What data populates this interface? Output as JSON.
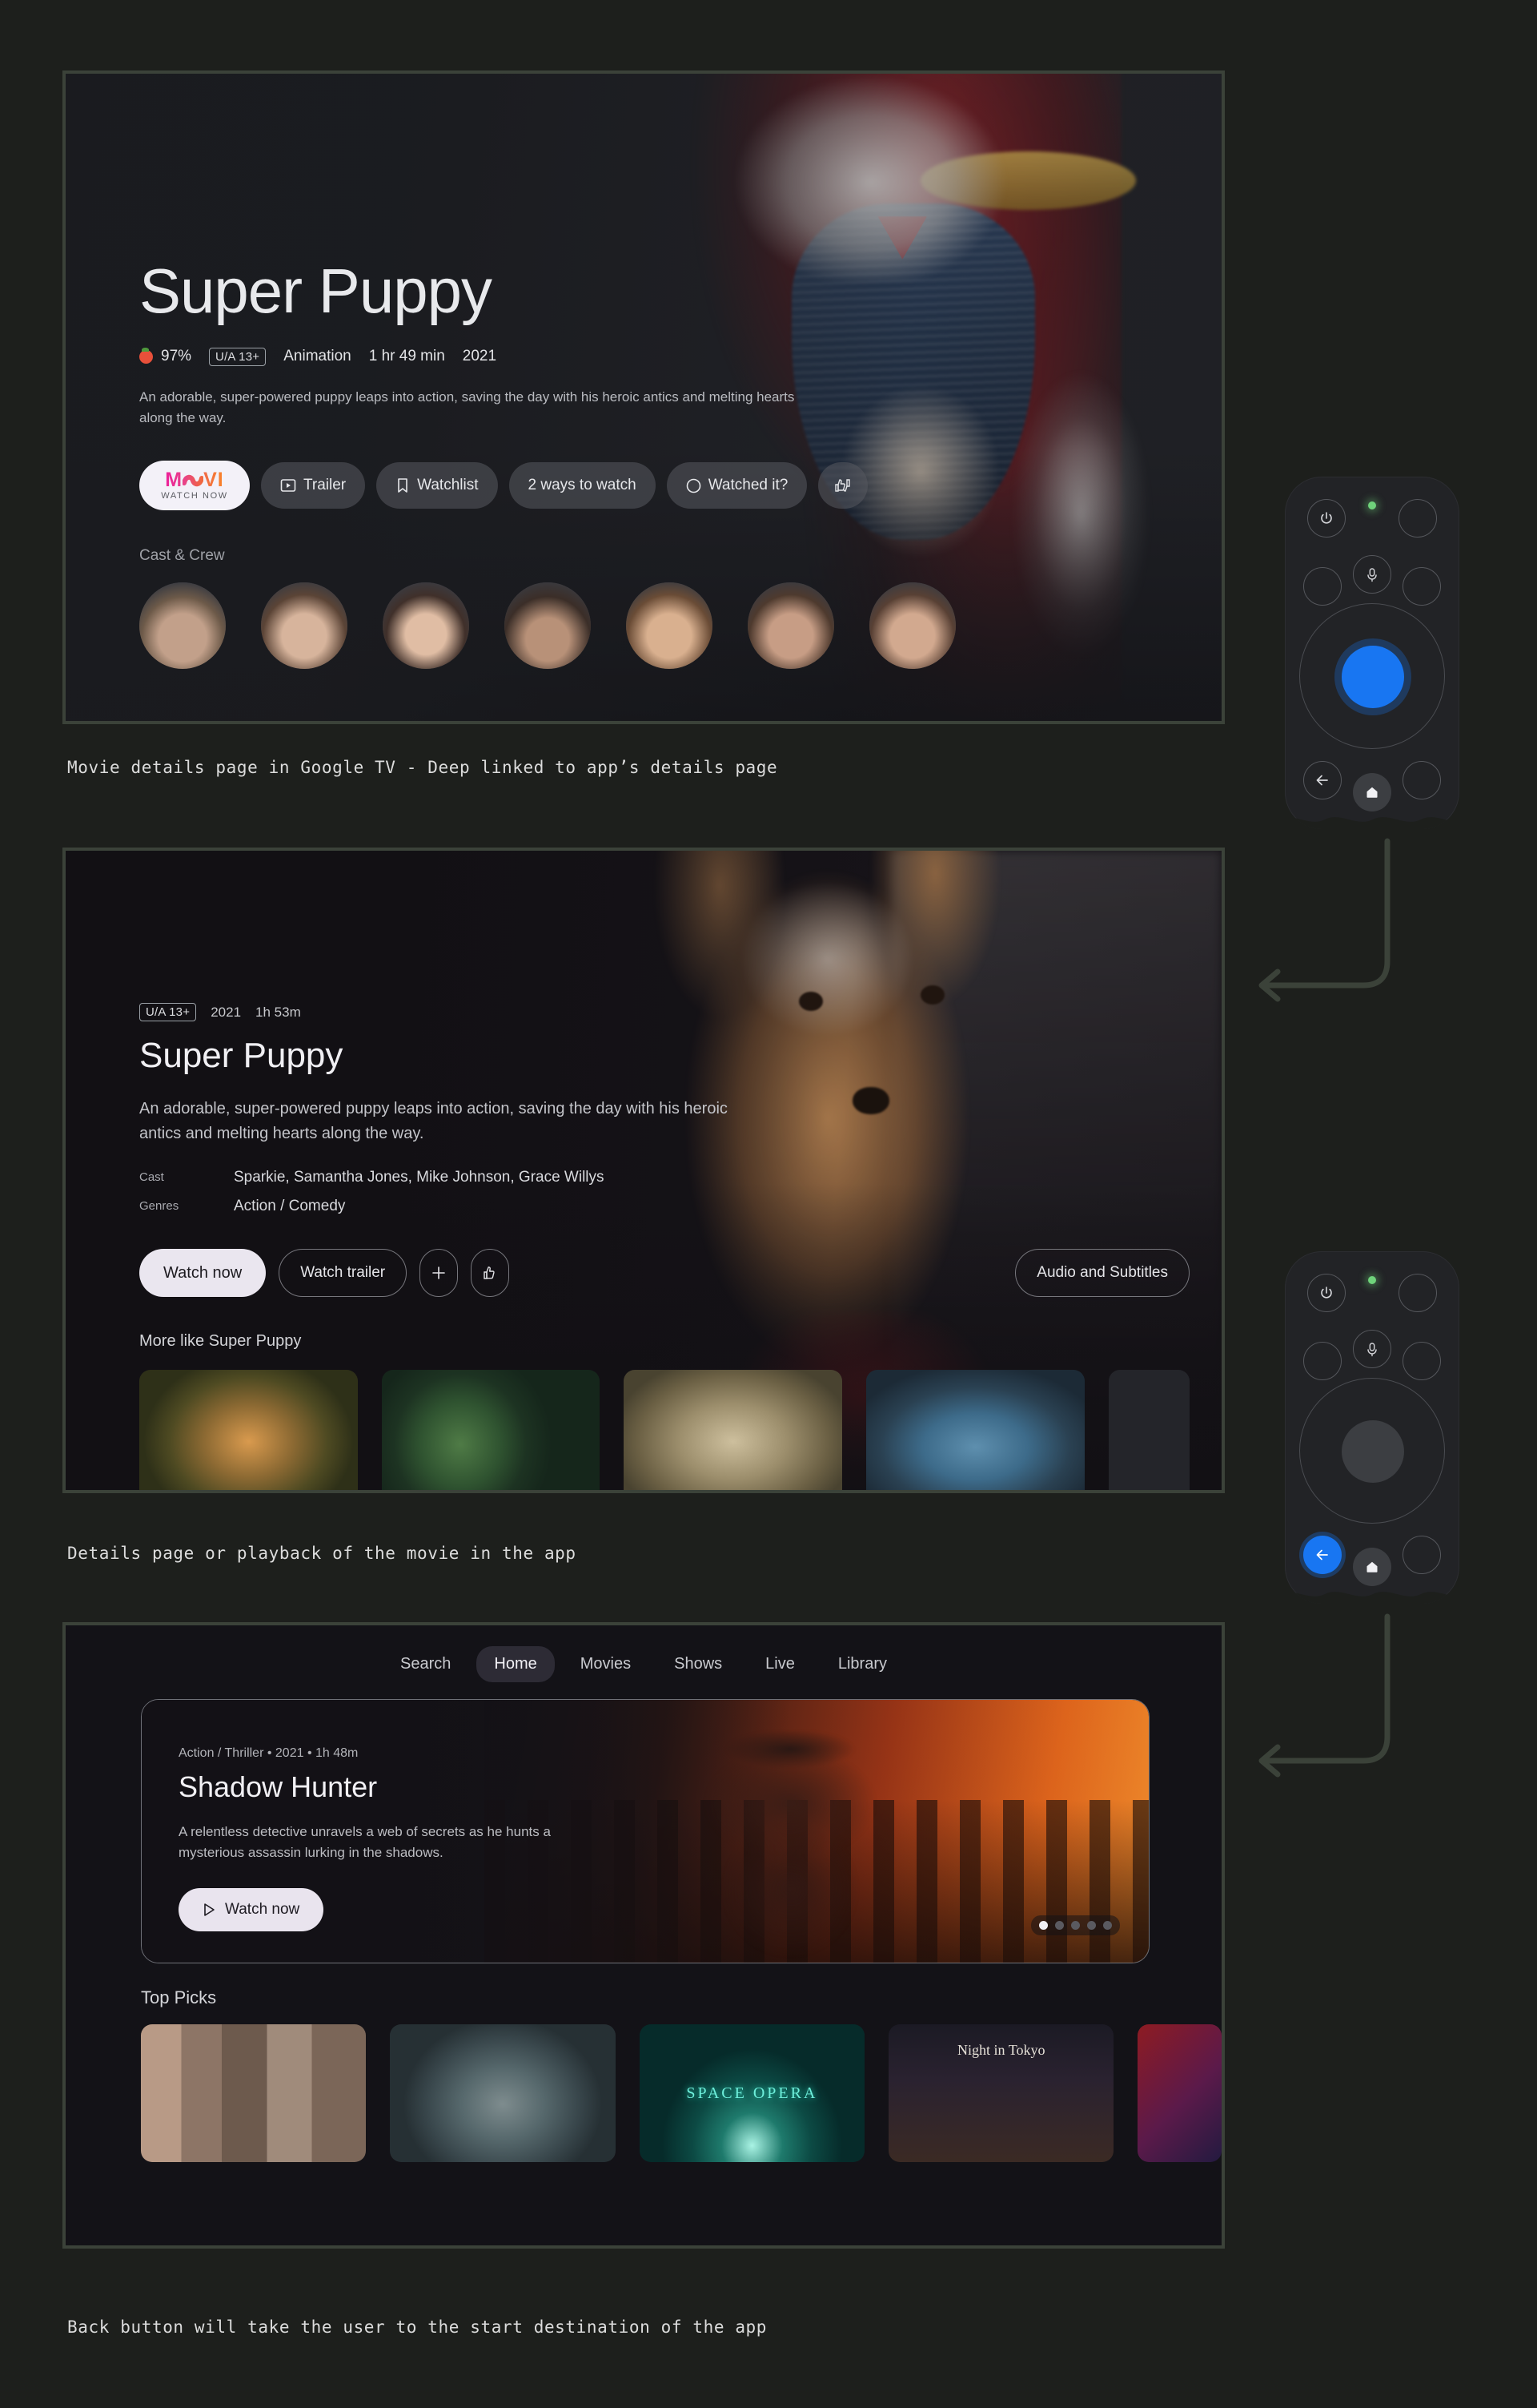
{
  "captions": {
    "first": "Movie details page in Google TV - Deep linked to app’s details page",
    "second": "Details page or playback of the movie in the app",
    "third": "Back button will take the user to the start destination of the app"
  },
  "colors": {
    "canvas": "#1d1f1c",
    "frame_border": "#3b4239",
    "accent_blue": "#1876f2",
    "led_green": "#6fd37b",
    "tomato_red": "#e8503a",
    "movi_gradient_start": "#ec1e9a",
    "movi_gradient_end": "#f98327",
    "light_button": "#eae6ef"
  },
  "google_tv_details": {
    "title": "Super Puppy",
    "score": "97%",
    "score_icon": "rotten-tomatoes-icon",
    "rating": "U/A 13+",
    "genre": "Animation",
    "duration": "1 hr 49 min",
    "year": "2021",
    "description": "An adorable, super-powered puppy leaps into action, saving the day with his heroic antics and melting hearts along the way.",
    "primary_button": {
      "logo_text": "M●VI",
      "logo_letters_left": "M",
      "logo_letters_right": "VI",
      "sub_label": "WATCH NOW"
    },
    "actions": [
      {
        "label": "Trailer",
        "icon": "play-box-icon"
      },
      {
        "label": "Watchlist",
        "icon": "bookmark-icon"
      },
      {
        "label": "2 ways to watch",
        "icon": "none"
      },
      {
        "label": "Watched it?",
        "icon": "circle-icon"
      },
      {
        "label": "",
        "icon": "thumbs-updown-icon"
      }
    ],
    "cast_section_label": "Cast & Crew"
  },
  "app_details": {
    "rating": "U/A 13+",
    "year": "2021",
    "duration": "1h 53m",
    "title": "Super Puppy",
    "description": "An adorable, super-powered puppy leaps into action, saving the day with his heroic antics and melting hearts along the way.",
    "fields": [
      {
        "key": "Cast",
        "value": "Sparkie, Samantha Jones, Mike Johnson, Grace Willys"
      },
      {
        "key": "Genres",
        "value": "Action / Comedy"
      }
    ],
    "buttons": {
      "watch_now": "Watch now",
      "watch_trailer": "Watch trailer",
      "add": "+",
      "like": "thumbs-up-icon",
      "audio_subtitles": "Audio and Subtitles"
    },
    "rail_title": "More like Super Puppy",
    "rail_items": [
      {
        "name": "tiger-cub-poster"
      },
      {
        "name": "hedgehog-poster"
      },
      {
        "name": "monkeys-poster"
      },
      {
        "name": "birds-poster"
      },
      {
        "name": "partial-poster"
      }
    ]
  },
  "app_home": {
    "nav": [
      {
        "label": "Search",
        "active": false
      },
      {
        "label": "Home",
        "active": true
      },
      {
        "label": "Movies",
        "active": false
      },
      {
        "label": "Shows",
        "active": false
      },
      {
        "label": "Live",
        "active": false
      },
      {
        "label": "Library",
        "active": false
      }
    ],
    "hero": {
      "meta": "Action / Thriller • 2021 • 1h 48m",
      "title": "Shadow Hunter",
      "description": "A relentless detective unravels a web of secrets as he hunts a mysterious assassin lurking in the shadows.",
      "button_label": "Watch now",
      "button_icon": "play-icon",
      "dots_total": 5,
      "dots_active_index": 0
    },
    "rail_title": "Top Picks",
    "rail_items": [
      {
        "name": "agents-poster",
        "caption": ""
      },
      {
        "name": "ape-poster",
        "caption": ""
      },
      {
        "name": "space-opera-poster",
        "caption": "SPACE OPERA"
      },
      {
        "name": "night-in-tokyo-poster",
        "caption": "Night in Tokyo"
      },
      {
        "name": "partial-poster",
        "caption": ""
      }
    ]
  },
  "remote_top": {
    "name": "google-tv-remote-select-highlighted",
    "buttons": [
      {
        "name": "power-button",
        "icon": "power-icon",
        "state": "normal"
      },
      {
        "name": "status-led",
        "icon": "led-indicator",
        "state": "on"
      },
      {
        "name": "input-button",
        "icon": "none",
        "state": "normal"
      },
      {
        "name": "left-aux-button",
        "icon": "none",
        "state": "normal"
      },
      {
        "name": "assistant-button",
        "icon": "microphone-icon",
        "state": "normal"
      },
      {
        "name": "right-aux-button",
        "icon": "none",
        "state": "normal"
      },
      {
        "name": "dpad-select-button",
        "icon": "none",
        "state": "highlighted"
      },
      {
        "name": "back-button",
        "icon": "back-arrow-icon",
        "state": "normal"
      },
      {
        "name": "home-button",
        "icon": "home-icon",
        "state": "filled"
      },
      {
        "name": "right-bottom-button",
        "icon": "none",
        "state": "normal"
      }
    ]
  },
  "remote_bottom": {
    "name": "google-tv-remote-back-highlighted",
    "buttons": [
      {
        "name": "power-button",
        "icon": "power-icon",
        "state": "normal"
      },
      {
        "name": "status-led",
        "icon": "led-indicator",
        "state": "on"
      },
      {
        "name": "input-button",
        "icon": "none",
        "state": "normal"
      },
      {
        "name": "left-aux-button",
        "icon": "none",
        "state": "normal"
      },
      {
        "name": "assistant-button",
        "icon": "microphone-icon",
        "state": "normal"
      },
      {
        "name": "right-aux-button",
        "icon": "none",
        "state": "normal"
      },
      {
        "name": "dpad-select-button",
        "icon": "none",
        "state": "normal"
      },
      {
        "name": "back-button",
        "icon": "back-arrow-icon",
        "state": "highlighted"
      },
      {
        "name": "home-button",
        "icon": "home-icon",
        "state": "filled"
      },
      {
        "name": "right-bottom-button",
        "icon": "none",
        "state": "normal"
      }
    ]
  }
}
